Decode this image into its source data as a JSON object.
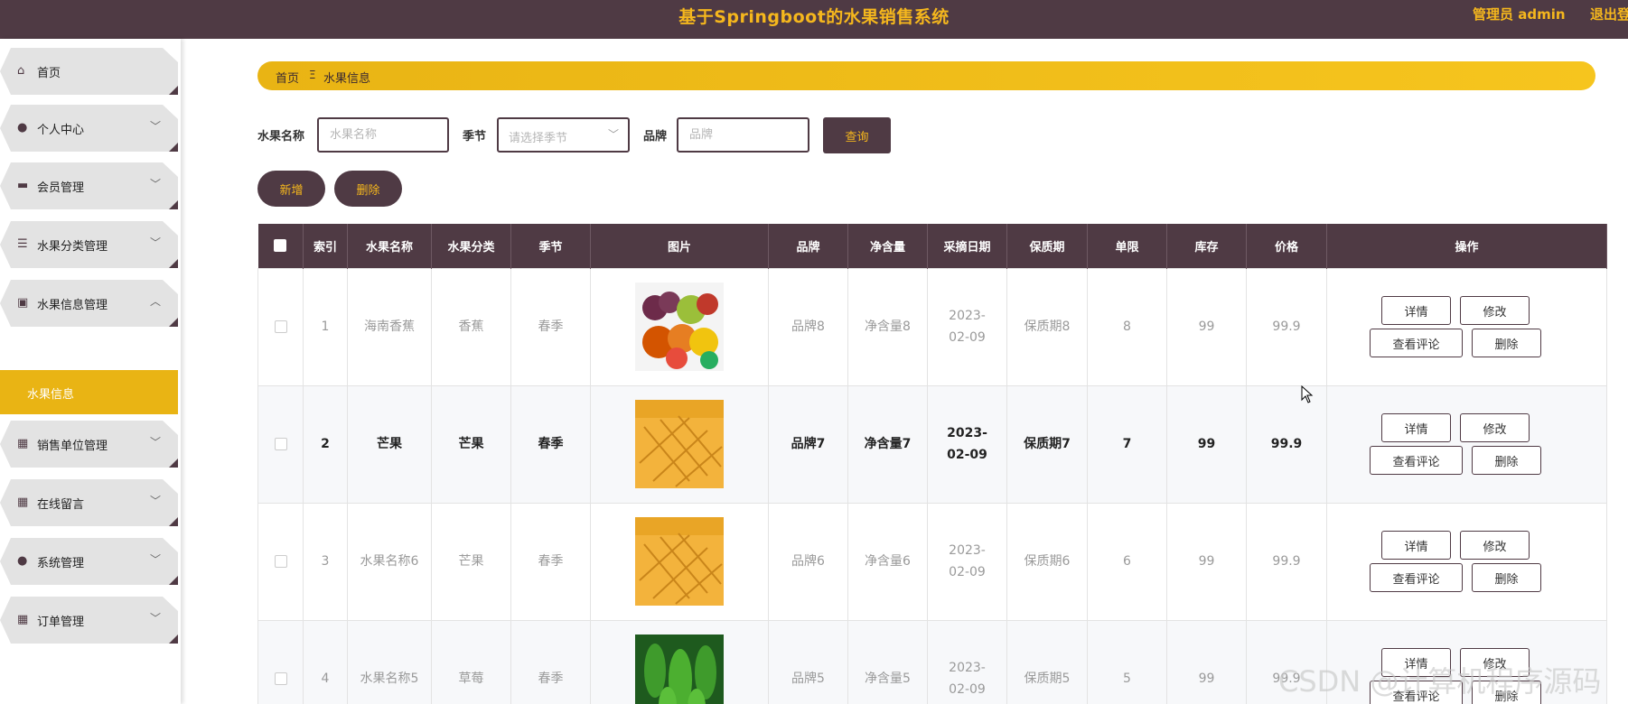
{
  "header": {
    "title": "基于Springboot的水果销售系统",
    "admin": "管理员 admin",
    "logout": "退出登"
  },
  "sidebar": {
    "items": [
      {
        "label": "首页",
        "icon": "home-icon",
        "glyph": "⌂",
        "expandable": false
      },
      {
        "label": "个人中心",
        "icon": "user-icon",
        "glyph": "●",
        "expandable": true
      },
      {
        "label": "会员管理",
        "icon": "monitor-icon",
        "glyph": "▬",
        "expandable": true
      },
      {
        "label": "水果分类管理",
        "icon": "sliders-icon",
        "glyph": "☰",
        "expandable": true
      },
      {
        "label": "水果信息管理",
        "icon": "clipboard-icon",
        "glyph": "▣",
        "expandable": true,
        "expanded": true
      },
      {
        "label": "销售单位管理",
        "icon": "grid-icon",
        "glyph": "▦",
        "expandable": true
      },
      {
        "label": "在线留言",
        "icon": "grid-icon",
        "glyph": "▦",
        "expandable": true
      },
      {
        "label": "系统管理",
        "icon": "user-icon",
        "glyph": "●",
        "expandable": true
      },
      {
        "label": "订单管理",
        "icon": "grid-icon",
        "glyph": "▦",
        "expandable": true
      }
    ],
    "active_sub": "水果信息"
  },
  "breadcrumb": {
    "home": "首页",
    "separator": "Ξ",
    "current": "水果信息"
  },
  "search": {
    "name_label": "水果名称",
    "name_placeholder": "水果名称",
    "season_label": "季节",
    "season_placeholder": "请选择季节",
    "brand_label": "品牌",
    "brand_placeholder": "品牌",
    "query_button": "查询"
  },
  "actions": {
    "add": "新增",
    "delete": "删除"
  },
  "table": {
    "columns": [
      "索引",
      "水果名称",
      "水果分类",
      "季节",
      "图片",
      "品牌",
      "净含量",
      "采摘日期",
      "保质期",
      "单限",
      "库存",
      "价格",
      "操作"
    ],
    "rows": [
      {
        "index": "1",
        "name": "海南香蕉",
        "category": "香蕉",
        "season": "春季",
        "image": "mixed-fruit-image",
        "brand": "品牌8",
        "net": "净含量8",
        "date": "2023-02-09",
        "shelf": "保质期8",
        "limit": "8",
        "stock": "99",
        "price": "99.9"
      },
      {
        "index": "2",
        "name": "芒果",
        "category": "芒果",
        "season": "春季",
        "image": "mango-image",
        "brand": "品牌7",
        "net": "净含量7",
        "date": "2023-02-09",
        "shelf": "保质期7",
        "limit": "7",
        "stock": "99",
        "price": "99.9"
      },
      {
        "index": "3",
        "name": "水果名称6",
        "category": "芒果",
        "season": "春季",
        "image": "mango-image",
        "brand": "品牌6",
        "net": "净含量6",
        "date": "2023-02-09",
        "shelf": "保质期6",
        "limit": "6",
        "stock": "99",
        "price": "99.9"
      },
      {
        "index": "4",
        "name": "水果名称5",
        "category": "草莓",
        "season": "春季",
        "image": "pepper-image",
        "brand": "品牌5",
        "net": "净含量5",
        "date": "2023-02-09",
        "shelf": "保质期5",
        "limit": "5",
        "stock": "99",
        "price": "99.9"
      }
    ],
    "ops": {
      "detail": "详情",
      "edit": "修改",
      "comments": "查看评论",
      "delete": "删除"
    }
  },
  "watermark": "CSDN @计算机程序源码",
  "colors": {
    "primary": "#4f3a44",
    "accent": "#f5b71d",
    "active": "#e9b414"
  }
}
